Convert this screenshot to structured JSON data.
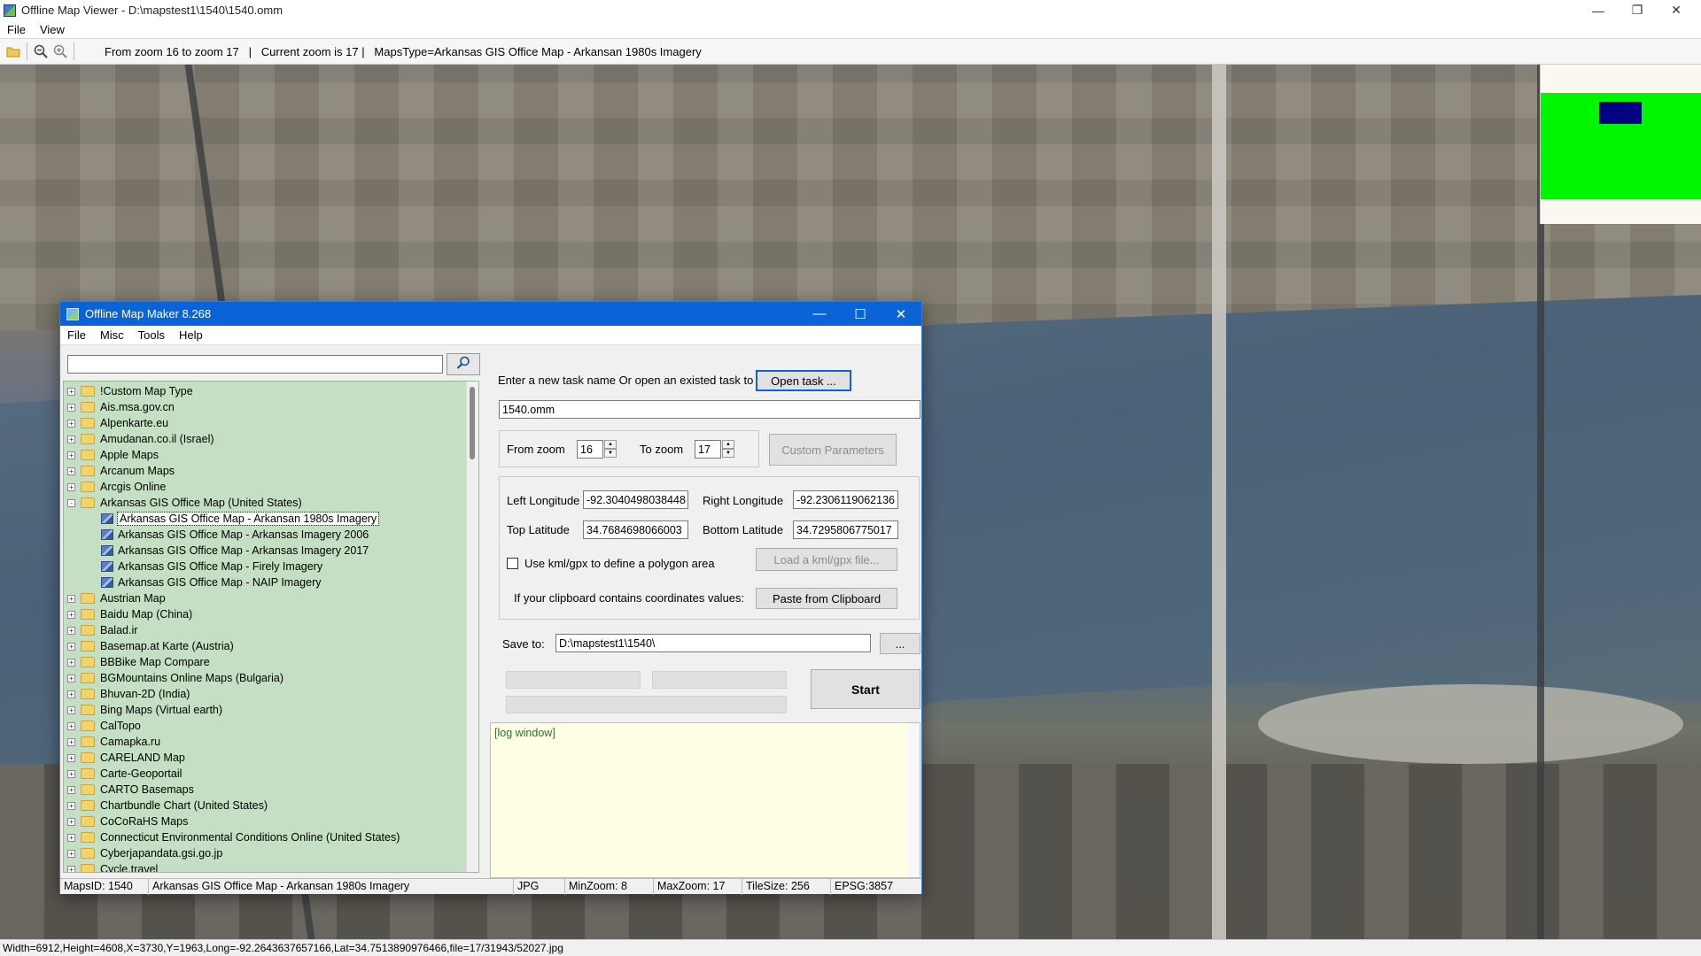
{
  "window": {
    "title": "Offline Map Viewer - D:\\mapstest1\\1540\\1540.omm",
    "menu": [
      "File",
      "View"
    ]
  },
  "toolbar": {
    "info": "From zoom 16 to zoom 17   |   Current zoom is 17 |   MapsType=Arkansas GIS Office Map - Arkansan 1980s Imagery",
    "icons": [
      "open-folder-icon",
      "zoom-out-icon",
      "zoom-in-icon"
    ]
  },
  "statusbar": {
    "text": "Width=6912,Height=4608,X=3730,Y=1963,Long=-92.2643637657166,Lat=34.7513890976466,file=17/31943/52027.jpg"
  },
  "colors": {
    "minimap_view": "#00f600",
    "minimap_cursor": "#000080",
    "dialog_title": "#0a64d8",
    "tree_bg": "#c4dfc4",
    "log_bg": "#ffffe6"
  },
  "dialog": {
    "title": "Offline Map Maker 8.268",
    "menu": [
      "File",
      "Misc",
      "Tools",
      "Help"
    ],
    "search": {
      "value": "",
      "placeholder": ""
    },
    "tree": [
      {
        "label": "!Custom Map Type",
        "level": 0,
        "expanded": false
      },
      {
        "label": "Ais.msa.gov.cn",
        "level": 0,
        "expanded": false
      },
      {
        "label": "Alpenkarte.eu",
        "level": 0,
        "expanded": false
      },
      {
        "label": "Amudanan.co.il (Israel)",
        "level": 0,
        "expanded": false
      },
      {
        "label": "Apple Maps",
        "level": 0,
        "expanded": false
      },
      {
        "label": "Arcanum Maps",
        "level": 0,
        "expanded": false
      },
      {
        "label": "Arcgis Online",
        "level": 0,
        "expanded": false
      },
      {
        "label": "Arkansas GIS Office Map (United States)",
        "level": 0,
        "expanded": true
      },
      {
        "label": "Arkansas GIS Office Map - Arkansan 1980s Imagery",
        "level": 1,
        "selected": true
      },
      {
        "label": "Arkansas GIS Office Map - Arkansas Imagery 2006",
        "level": 1
      },
      {
        "label": "Arkansas GIS Office Map - Arkansas Imagery 2017",
        "level": 1
      },
      {
        "label": "Arkansas GIS Office Map - Firely Imagery",
        "level": 1
      },
      {
        "label": "Arkansas GIS Office Map - NAIP Imagery",
        "level": 1
      },
      {
        "label": "Austrian Map",
        "level": 0,
        "expanded": false
      },
      {
        "label": "Baidu Map (China)",
        "level": 0,
        "expanded": false
      },
      {
        "label": "Balad.ir",
        "level": 0,
        "expanded": false
      },
      {
        "label": "Basemap.at Karte (Austria)",
        "level": 0,
        "expanded": false
      },
      {
        "label": "BBBike Map Compare",
        "level": 0,
        "expanded": false
      },
      {
        "label": "BGMountains Online Maps (Bulgaria)",
        "level": 0,
        "expanded": false
      },
      {
        "label": "Bhuvan-2D (India)",
        "level": 0,
        "expanded": false
      },
      {
        "label": "Bing Maps (Virtual earth)",
        "level": 0,
        "expanded": false
      },
      {
        "label": "CalTopo",
        "level": 0,
        "expanded": false
      },
      {
        "label": "Camapka.ru",
        "level": 0,
        "expanded": false
      },
      {
        "label": "CARELAND Map",
        "level": 0,
        "expanded": false
      },
      {
        "label": "Carte-Geoportail",
        "level": 0,
        "expanded": false
      },
      {
        "label": "CARTO Basemaps",
        "level": 0,
        "expanded": false
      },
      {
        "label": "Chartbundle Chart (United States)",
        "level": 0,
        "expanded": false
      },
      {
        "label": "CoCoRaHS Maps",
        "level": 0,
        "expanded": false
      },
      {
        "label": "Connecticut Environmental Conditions Online (United States)",
        "level": 0,
        "expanded": false
      },
      {
        "label": "Cyberjapandata.gsi.go.jp",
        "level": 0,
        "expanded": false
      },
      {
        "label": "Cycle.travel",
        "level": 0,
        "expanded": false
      }
    ],
    "task": {
      "prompt": "Enter a new task name Or open an existed task to continue:",
      "open_button": "Open task ...",
      "name_value": "1540.omm"
    },
    "zoom": {
      "from_label": "From zoom",
      "from_value": "16",
      "to_label": "To zoom",
      "to_value": "17",
      "custom_button": "Custom Parameters"
    },
    "coords": {
      "left_lon_label": "Left Longitude",
      "left_lon_value": "-92.3040498038448",
      "right_lon_label": "Right Longitude",
      "right_lon_value": "-92.2306119062136",
      "top_lat_label": "Top Latitude",
      "top_lat_value": "34.7684698066003",
      "bottom_lat_label": "Bottom Latitude",
      "bottom_lat_value": "34.7295806775017",
      "kml_checkbox_label": "Use kml/gpx to define a polygon area",
      "kml_button": "Load a kml/gpx file...",
      "clipboard_label": "If your clipboard contains coordinates values:",
      "clipboard_button": "Paste from Clipboard"
    },
    "save": {
      "label": "Save to:",
      "path_value": "D:\\mapstest1\\1540\\",
      "browse_button": "...",
      "start_button": "Start"
    },
    "log": {
      "text": "[log window]"
    },
    "status": {
      "maps_id": "MapsID: 1540",
      "map_name": "Arkansas GIS Office Map - Arkansan 1980s Imagery",
      "format": "JPG",
      "min_zoom": "MinZoom: 8",
      "max_zoom": "MaxZoom: 17",
      "tile_size": "TileSize: 256",
      "epsg": "EPSG:3857"
    }
  }
}
